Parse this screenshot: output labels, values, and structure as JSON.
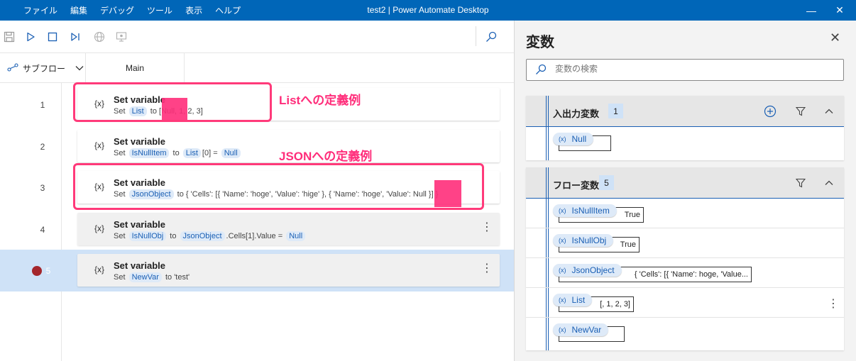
{
  "titlebar": {
    "menu": [
      "ファイル",
      "編集",
      "デバッグ",
      "ツール",
      "表示",
      "ヘルプ"
    ],
    "title": "test2 | Power Automate Desktop",
    "minimize": "—",
    "close": "✕"
  },
  "toolbar": {
    "icons": [
      "save-icon",
      "run-icon",
      "stop-icon",
      "run-next-action-icon",
      "web-recorder-icon",
      "desktop-recorder-icon",
      "search-icon"
    ]
  },
  "tabs": {
    "subflow_label": "サブフロー",
    "main_label": "Main"
  },
  "actions": [
    {
      "num": "1",
      "icon": "{x}",
      "title": "Set variable",
      "set": "Set",
      "var": "List",
      "to": "to",
      "rest": "[Null, 1, 2, 3]"
    },
    {
      "num": "2",
      "icon": "{x}",
      "title": "Set variable",
      "set": "Set",
      "var": "IsNullItem",
      "to": "to",
      "ref": "List",
      "ref2": "[0] =",
      "val": "Null"
    },
    {
      "num": "3",
      "icon": "{x}",
      "title": "Set variable",
      "set": "Set",
      "var": "JsonObject",
      "to": "to",
      "rest": "{ 'Cells': [{ 'Name': 'hoge', 'Value': 'hige' }, { 'Name': 'hoge', 'Value': Null }] }"
    },
    {
      "num": "4",
      "icon": "{x}",
      "title": "Set variable",
      "set": "Set",
      "var": "IsNullObj",
      "to": "to",
      "ref": "JsonObject",
      "ref2": ".Cells[1].Value =",
      "val": "Null"
    },
    {
      "num": "5",
      "icon": "{x}",
      "title": "Set variable",
      "set": "Set",
      "var": "NewVar",
      "to": "to",
      "rest": "'test'"
    }
  ],
  "annotations": {
    "list_label": "Listへの定義例",
    "json_label": "JSONへの定義例",
    "highlight_color": "#ff2d7a"
  },
  "variables_pane": {
    "title": "変数",
    "close": "✕",
    "search_placeholder": "変数の検索",
    "io_group": {
      "name": "入出力変数",
      "count": "1",
      "items": [
        {
          "name": "Null",
          "value": ""
        }
      ]
    },
    "flow_group": {
      "name": "フロー変数",
      "count": "5",
      "items": [
        {
          "name": "IsNullItem",
          "value": "True"
        },
        {
          "name": "IsNullObj",
          "value": "True"
        },
        {
          "name": "JsonObject",
          "value": "{ 'Cells': [{ 'Name': hoge, 'Value..."
        },
        {
          "name": "List",
          "value": "[, 1, 2, 3]"
        },
        {
          "name": "NewVar",
          "value": ""
        }
      ]
    }
  },
  "colors": {
    "titlebar": "#0066b8",
    "accent": "#1a5fb4",
    "selected_row": "#cfe2f7",
    "breakpoint": "#a4262c"
  }
}
